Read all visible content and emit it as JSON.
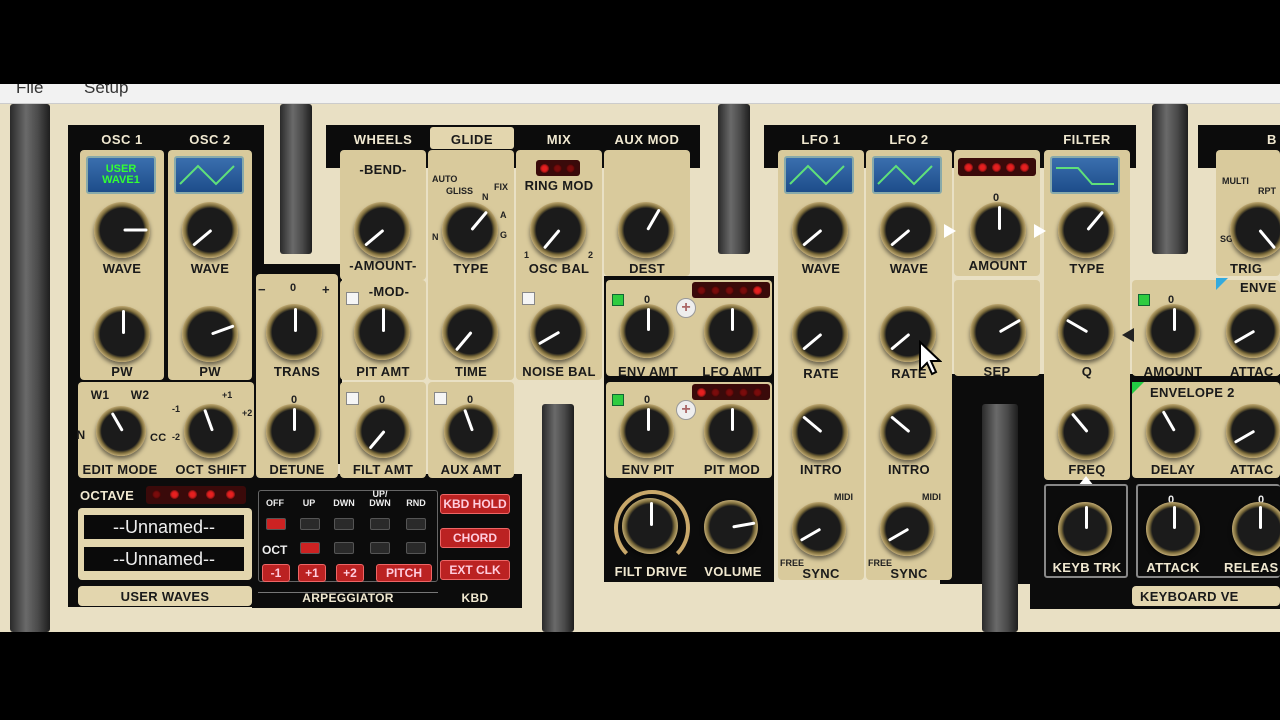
{
  "menu": {
    "file": "File",
    "setup": "Setup"
  },
  "headers": {
    "osc1": "OSC 1",
    "osc2": "OSC 2",
    "wheels": "WHEELS",
    "glide": "GLIDE",
    "mix": "MIX",
    "aux_mod": "AUX MOD",
    "lfo1": "LFO 1",
    "lfo2": "LFO 2",
    "filter": "FILTER"
  },
  "osc1": {
    "screen": "USER WAVE1",
    "wave": "WAVE",
    "pw": "PW",
    "w1": "W1",
    "w2": "W2",
    "n": "N",
    "cc": "CC",
    "edit_mode": "EDIT MODE"
  },
  "osc2": {
    "wave": "WAVE",
    "pw": "PW",
    "oct_shift": "OCT SHIFT",
    "oct_m1": "-1",
    "oct_m2": "-2",
    "oct_p1": "+1",
    "oct_p2": "+2"
  },
  "trans": {
    "label": "TRANS",
    "minus": "−",
    "zero": "0",
    "plus": "+"
  },
  "detune": {
    "label": "DETUNE",
    "zero": "0"
  },
  "wheels": {
    "bend": "-BEND-",
    "amount": "-AMOUNT-",
    "mod": "-MOD-",
    "pit_amt": "PIT AMT",
    "filt_amt": "FILT AMT",
    "filt_zero": "0"
  },
  "glide": {
    "type": "TYPE",
    "time": "TIME",
    "auto": "AUTO",
    "gliss": "GLISS",
    "fix": "FIX",
    "n": "N",
    "a": "A",
    "g": "G",
    "n2": "N",
    "aux_amt": "AUX AMT",
    "aux_zero": "0"
  },
  "mix": {
    "ring_mod": "RING MOD",
    "osc_bal": "OSC BAL",
    "noise_bal": "NOISE BAL",
    "one": "1",
    "two": "2"
  },
  "aux_mod": {
    "dest": "DEST",
    "env_amt": "ENV AMT",
    "lfo_amt": "LFO AMT",
    "env_pit": "ENV PIT",
    "pit_mod": "PIT MOD",
    "zero1": "0",
    "zero2": "0"
  },
  "output": {
    "filt_drive": "FILT DRIVE",
    "volume": "VOLUME"
  },
  "lfo1": {
    "wave": "WAVE",
    "rate": "RATE",
    "intro": "INTRO",
    "sync": "SYNC",
    "midi": "MIDI",
    "free": "FREE"
  },
  "lfo2": {
    "wave": "WAVE",
    "rate": "RATE",
    "intro": "INTRO",
    "sync": "SYNC",
    "midi": "MIDI",
    "free": "FREE"
  },
  "lfo_amount": {
    "label": "AMOUNT",
    "zero": "0",
    "sep": "SEP"
  },
  "filter": {
    "type": "TYPE",
    "q": "Q",
    "freq": "FREQ",
    "keyb_trk": "KEYB TRK"
  },
  "envelope": {
    "amount": "AMOUNT",
    "zero": "0",
    "env2": "ENVELOPE 2",
    "delay": "DELAY",
    "attack": "ATTAC",
    "attack2": "ATTAC",
    "attack3": "ATTACK",
    "release": "RELEAS",
    "zero2": "0",
    "zero3": "0"
  },
  "right_panel": {
    "multi": "MULTI",
    "rpt": "RPT",
    "sg": "SG",
    "trig": "TRIG",
    "enve": "ENVE",
    "b": "B"
  },
  "octave": {
    "label": "OCTAVE"
  },
  "patch": {
    "name1": "--Unnamed--",
    "name2": "--Unnamed--",
    "user_waves": "USER WAVES"
  },
  "arp": {
    "cols": [
      "OFF",
      "UP",
      "DWN",
      "UP/ DWN",
      "RND"
    ],
    "oct": "OCT",
    "buttons": [
      "-1",
      "+1",
      "+2",
      "PITCH"
    ],
    "kbd_hold": "KBD HOLD",
    "chord": "CHORD",
    "ext_clk": "EXT CLK",
    "label": "ARPEGGIATOR",
    "kbd": "KBD"
  },
  "footer": {
    "keyboard_vel": "KEYBOARD VE"
  }
}
